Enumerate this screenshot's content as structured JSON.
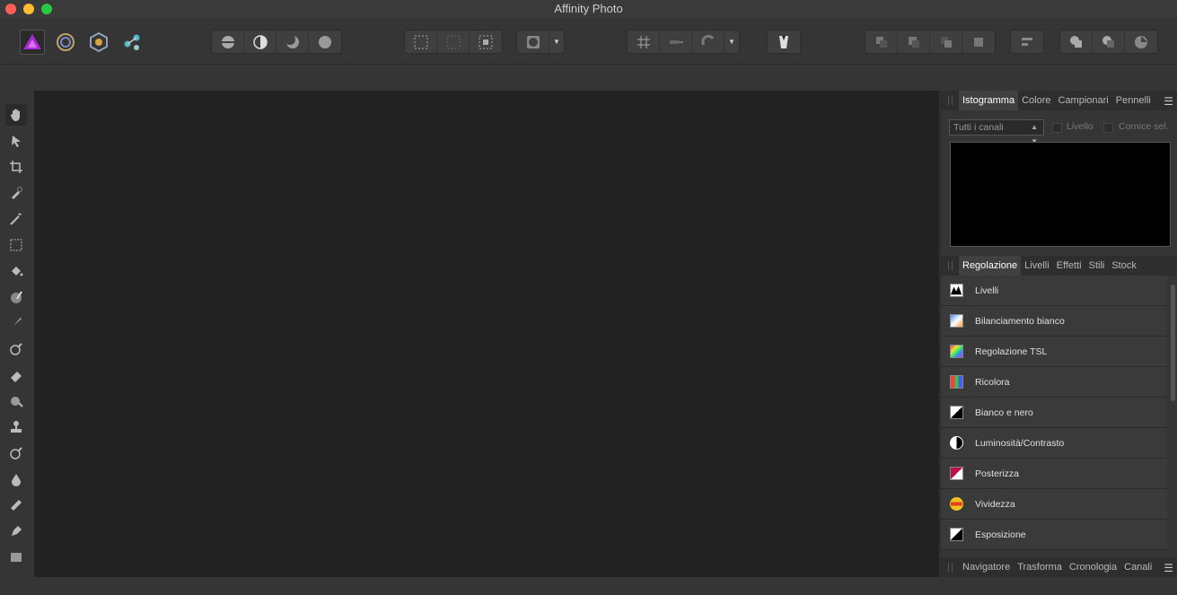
{
  "window": {
    "title": "Affinity Photo"
  },
  "personas": [
    "photo-persona-icon",
    "liquify-persona-icon",
    "develop-persona-icon",
    "export-persona-icon"
  ],
  "histogram_panel": {
    "tabs": [
      {
        "label": "Istogramma",
        "active": true
      },
      {
        "label": "Colore"
      },
      {
        "label": "Campionari"
      },
      {
        "label": "Pennelli"
      }
    ],
    "channel_select": "Tutti i canali",
    "layer_checkbox": "Livello",
    "marquee_checkbox": "Cornice sel."
  },
  "adjustment_panel": {
    "tabs": [
      {
        "label": "Regolazione",
        "active": true
      },
      {
        "label": "Livelli"
      },
      {
        "label": "Effetti"
      },
      {
        "label": "Stili"
      },
      {
        "label": "Stock"
      }
    ],
    "items": [
      {
        "label": "Livelli",
        "icon": "levels-icon"
      },
      {
        "label": "Bilanciamento bianco",
        "icon": "white-balance-icon"
      },
      {
        "label": "Regolazione TSL",
        "icon": "hsl-icon"
      },
      {
        "label": "Ricolora",
        "icon": "recolor-icon"
      },
      {
        "label": "Bianco e nero",
        "icon": "black-white-icon"
      },
      {
        "label": "Luminosità/Contrasto",
        "icon": "brightness-contrast-icon"
      },
      {
        "label": "Posterizza",
        "icon": "posterize-icon"
      },
      {
        "label": "Vividezza",
        "icon": "vibrance-icon"
      },
      {
        "label": "Esposizione",
        "icon": "exposure-icon"
      }
    ]
  },
  "bottom_panel": {
    "tabs": [
      {
        "label": "Navigatore"
      },
      {
        "label": "Trasforma"
      },
      {
        "label": "Cronologia"
      },
      {
        "label": "Canali"
      }
    ]
  },
  "colors": {
    "accent": "#a52bd8",
    "canvas": "#222222",
    "panel": "#353535"
  }
}
